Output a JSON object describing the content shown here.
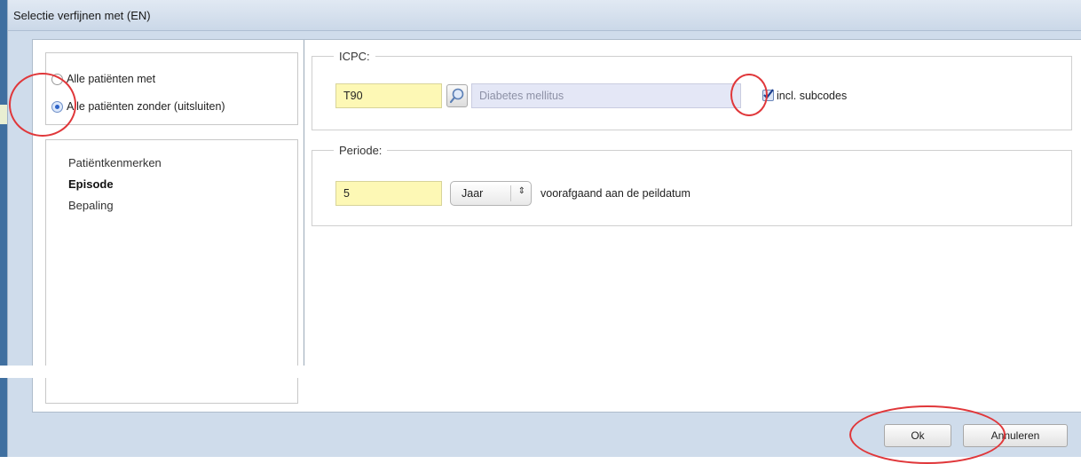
{
  "dialog": {
    "title": "Selectie verfijnen met (EN)"
  },
  "filter_mode": {
    "options": [
      {
        "label": "Alle patiënten met",
        "selected": false
      },
      {
        "label": "Alle patiënten zonder (uitsluiten)",
        "selected": true
      }
    ]
  },
  "nav": {
    "items": [
      {
        "label": "Patiëntkenmerken",
        "active": false
      },
      {
        "label": "Episode",
        "active": true
      },
      {
        "label": "Bepaling",
        "active": false
      }
    ]
  },
  "icpc": {
    "legend": "ICPC:",
    "code": "T90",
    "description": "Diabetes mellitus",
    "include_subcodes_label": "incl. subcodes",
    "include_subcodes": true
  },
  "periode": {
    "legend": "Periode:",
    "value": "5",
    "unit": "Jaar",
    "suffix": "voorafgaand aan de peildatum"
  },
  "buttons": {
    "ok": "Ok",
    "cancel": "Annuleren"
  },
  "colors": {
    "annotation": "#e0373a",
    "input_highlight": "#fdf8b5",
    "titlebar": "#cbd8e8"
  }
}
